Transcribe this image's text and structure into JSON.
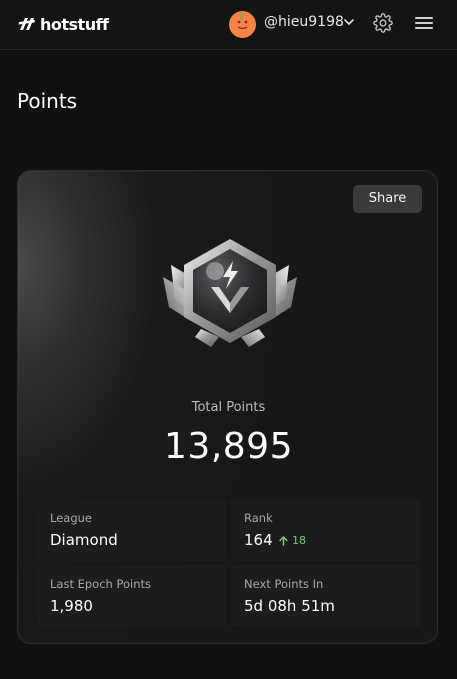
{
  "header": {
    "logo_text": "hotstuff",
    "username": "@hieu9198",
    "icons": [
      "logo-icon",
      "avatar",
      "chevron-down-icon",
      "gear-icon",
      "menu-icon"
    ]
  },
  "page": {
    "title": "Points"
  },
  "card": {
    "share_label": "Share",
    "badge_icon": "diamond-league-badge-icon",
    "total_label": "Total Points",
    "total_value": "13,895",
    "stats": [
      {
        "label": "League",
        "value": "Diamond"
      },
      {
        "label": "Rank",
        "value": "164",
        "delta": "18",
        "delta_color": "#6fcf6a"
      },
      {
        "label": "Last Epoch Points",
        "value": "1,980"
      },
      {
        "label": "Next Points In",
        "value": "5d 08h 51m"
      }
    ]
  },
  "colors": {
    "background": "#111111",
    "card": "#1b1b1b",
    "accent_up": "#6fcf6a",
    "avatar": "#f7834a"
  }
}
